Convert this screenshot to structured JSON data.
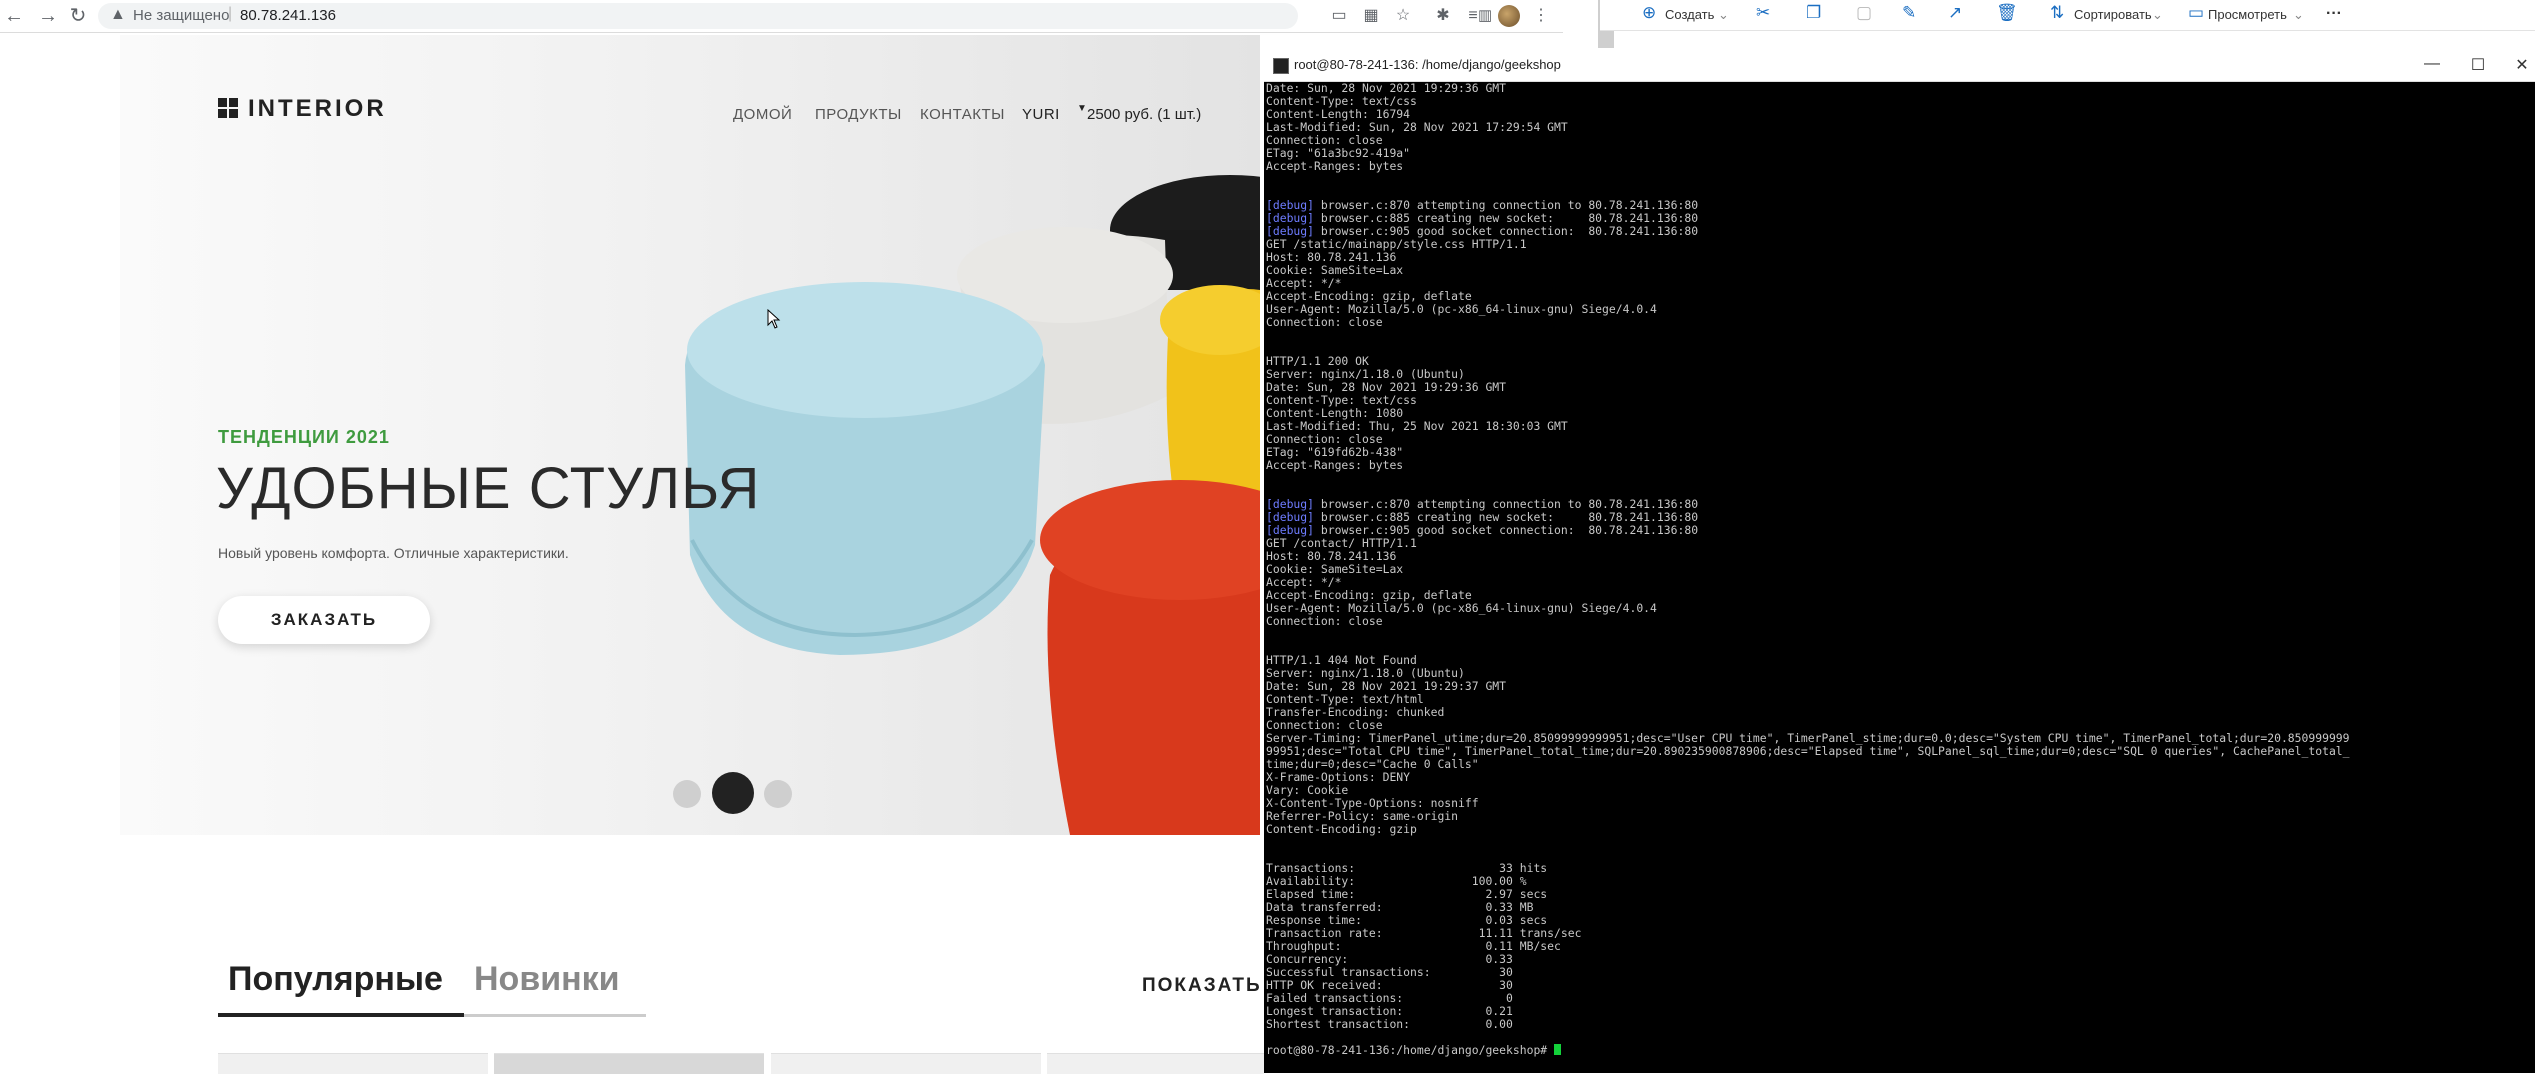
{
  "browser": {
    "back_icon": "←",
    "forward_icon": "→",
    "reload_icon": "↻",
    "security_icon": "▲",
    "security_label": "Не защищено",
    "url": "80.78.241.136",
    "toolbar_icons": [
      "screen-cast-icon",
      "translate-icon",
      "star-icon",
      "extensions-icon",
      "reading-list-icon",
      "split-icon",
      "avatar",
      "menu-dots-icon"
    ]
  },
  "explorer": {
    "create_label": "Создать",
    "sort_label": "Сортировать",
    "view_label": "Просмотреть",
    "more_label": "···"
  },
  "site": {
    "logo": "INTERIOR",
    "menu": [
      "ДОМОЙ",
      "ПРОДУКТЫ",
      "КОНТАКТЫ"
    ],
    "user": "YURI",
    "cart": "2500 руб. (1 шт.)",
    "hero": {
      "tag": "ТЕНДЕНЦИИ 2021",
      "title": "УДОБНЫЕ СТУЛЬЯ",
      "subtitle": "Новый уровень комфорта. Отличные характеристики.",
      "button": "ЗАКАЗАТЬ"
    },
    "slider_active": 2,
    "tabs": {
      "popular": "Популярные",
      "new": "Новинки"
    },
    "show_all": "ПОКАЗАТЬ"
  },
  "terminal": {
    "title": "root@80-78-241-136: /home/django/geekshop",
    "lines": [
      "Date: Sun, 28 Nov 2021 19:29:36 GMT",
      "Content-Type: text/css",
      "Content-Length: 16794",
      "Last-Modified: Sun, 28 Nov 2021 17:29:54 GMT",
      "Connection: close",
      "ETag: \"61a3bc92-419a\"",
      "Accept-Ranges: bytes",
      "",
      "",
      "[debug] browser.c:870 attempting connection to 80.78.241.136:80",
      "[debug] browser.c:885 creating new socket:     80.78.241.136:80",
      "[debug] browser.c:905 good socket connection:  80.78.241.136:80",
      "GET /static/mainapp/style.css HTTP/1.1",
      "Host: 80.78.241.136",
      "Cookie: SameSite=Lax",
      "Accept: */*",
      "Accept-Encoding: gzip, deflate",
      "User-Agent: Mozilla/5.0 (pc-x86_64-linux-gnu) Siege/4.0.4",
      "Connection: close",
      "",
      "",
      "HTTP/1.1 200 OK",
      "Server: nginx/1.18.0 (Ubuntu)",
      "Date: Sun, 28 Nov 2021 19:29:36 GMT",
      "Content-Type: text/css",
      "Content-Length: 1080",
      "Last-Modified: Thu, 25 Nov 2021 18:30:03 GMT",
      "Connection: close",
      "ETag: \"619fd62b-438\"",
      "Accept-Ranges: bytes",
      "",
      "",
      "[debug] browser.c:870 attempting connection to 80.78.241.136:80",
      "[debug] browser.c:885 creating new socket:     80.78.241.136:80",
      "[debug] browser.c:905 good socket connection:  80.78.241.136:80",
      "GET /contact/ HTTP/1.1",
      "Host: 80.78.241.136",
      "Cookie: SameSite=Lax",
      "Accept: */*",
      "Accept-Encoding: gzip, deflate",
      "User-Agent: Mozilla/5.0 (pc-x86_64-linux-gnu) Siege/4.0.4",
      "Connection: close",
      "",
      "",
      "HTTP/1.1 404 Not Found",
      "Server: nginx/1.18.0 (Ubuntu)",
      "Date: Sun, 28 Nov 2021 19:29:37 GMT",
      "Content-Type: text/html",
      "Transfer-Encoding: chunked",
      "Connection: close",
      "Server-Timing: TimerPanel_utime;dur=20.85099999999951;desc=\"User CPU time\", TimerPanel_stime;dur=0.0;desc=\"System CPU time\", TimerPanel_total;dur=20.850999999",
      "99951;desc=\"Total CPU time\", TimerPanel_total_time;dur=20.890235900878906;desc=\"Elapsed time\", SQLPanel_sql_time;dur=0;desc=\"SQL 0 queries\", CachePanel_total_",
      "time;dur=0;desc=\"Cache 0 Calls\"",
      "X-Frame-Options: DENY",
      "Vary: Cookie",
      "X-Content-Type-Options: nosniff",
      "Referrer-Policy: same-origin",
      "Content-Encoding: gzip",
      "",
      "",
      "Transactions:                     33 hits",
      "Availability:                 100.00 %",
      "Elapsed time:                   2.97 secs",
      "Data transferred:               0.33 MB",
      "Response time:                  0.03 secs",
      "Transaction rate:              11.11 trans/sec",
      "Throughput:                     0.11 MB/sec",
      "Concurrency:                    0.33",
      "Successful transactions:          30",
      "HTTP OK received:                 30",
      "Failed transactions:               0",
      "Longest transaction:            0.21",
      "Shortest transaction:           0.00",
      ""
    ],
    "prompt": "root@80-78-241-136:/home/django/geekshop# "
  },
  "colors": {
    "accent_green": "#3f9b3f",
    "terminal_bg": "#000000",
    "terminal_text": "#c8c8c8",
    "debug_blue": "#6e7cff",
    "cursor_green": "#13d13a"
  }
}
